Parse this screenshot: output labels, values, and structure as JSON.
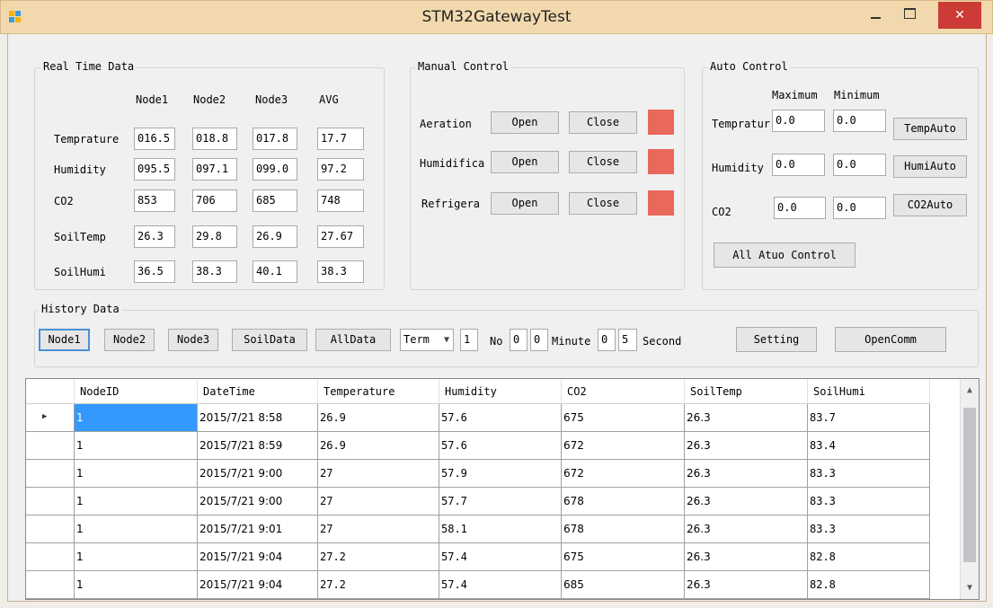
{
  "window": {
    "title": "STM32GatewayTest",
    "minimize_glyph": "—",
    "maximize_glyph": "☐",
    "close_glyph": "✕"
  },
  "realtime": {
    "title": "Real Time Data",
    "col_headers": [
      "Node1",
      "Node2",
      "Node3",
      "AVG"
    ],
    "rows": [
      {
        "label": "Temprature",
        "values": [
          "016.5",
          "018.8",
          "017.8",
          "17.7"
        ]
      },
      {
        "label": "Humidity",
        "values": [
          "095.5",
          "097.1",
          "099.0",
          "97.2"
        ]
      },
      {
        "label": "CO2",
        "values": [
          "853",
          "706",
          "685",
          "748"
        ]
      },
      {
        "label": "SoilTemp",
        "values": [
          "26.3",
          "29.8",
          "26.9",
          "27.67"
        ]
      },
      {
        "label": "SoilHumi",
        "values": [
          "36.5",
          "38.3",
          "40.1",
          "38.3"
        ]
      }
    ]
  },
  "manual": {
    "title": "Manual Control",
    "open_label": "Open",
    "close_label": "Close",
    "rows": [
      {
        "label": "Aeration"
      },
      {
        "label": "Humidifica"
      },
      {
        "label": "Refrigera"
      }
    ],
    "indicator_color": "#e8695b"
  },
  "auto": {
    "title": "Auto Control",
    "max_header": "Maximum",
    "min_header": "Minimum",
    "rows": [
      {
        "label": "Tempratur",
        "max": "0.0",
        "min": "0.0",
        "button": "TempAuto"
      },
      {
        "label": "Humidity",
        "max": "0.0",
        "min": "0.0",
        "button": "HumiAuto"
      },
      {
        "label": "CO2",
        "max": "0.0",
        "min": "0.0",
        "button": "CO2Auto"
      }
    ],
    "all_button": "All Atuo Control"
  },
  "history": {
    "title": "History Data",
    "buttons": [
      "Node1",
      "Node2",
      "Node3",
      "SoilData",
      "AllData"
    ],
    "combo_value": "Term",
    "no_value": "1",
    "no_label": "No",
    "minute_values": [
      "0",
      "0"
    ],
    "minute_label": "Minute",
    "second_values": [
      "0",
      "5"
    ],
    "second_label": "Second",
    "setting_button": "Setting",
    "opencomm_button": "OpenComm"
  },
  "grid": {
    "columns": [
      "NodeID",
      "DateTime",
      "Temperature",
      "Humidity",
      "CO2",
      "SoilTemp",
      "SoilHumi"
    ],
    "rows": [
      [
        "1",
        "2015/7/21 8:58",
        "26.9",
        "57.6",
        "675",
        "26.3",
        "83.7"
      ],
      [
        "1",
        "2015/7/21 8:59",
        "26.9",
        "57.6",
        "672",
        "26.3",
        "83.4"
      ],
      [
        "1",
        "2015/7/21 9:00",
        "27",
        "57.9",
        "672",
        "26.3",
        "83.3"
      ],
      [
        "1",
        "2015/7/21 9:00",
        "27",
        "57.7",
        "678",
        "26.3",
        "83.3"
      ],
      [
        "1",
        "2015/7/21 9:01",
        "27",
        "58.1",
        "678",
        "26.3",
        "83.3"
      ],
      [
        "1",
        "2015/7/21 9:04",
        "27.2",
        "57.4",
        "675",
        "26.3",
        "82.8"
      ],
      [
        "1",
        "2015/7/21 9:04",
        "27.2",
        "57.4",
        "685",
        "26.3",
        "82.8"
      ]
    ],
    "current_row_glyph": "▶",
    "scroll_up_glyph": "▲",
    "scroll_down_glyph": "▼"
  }
}
